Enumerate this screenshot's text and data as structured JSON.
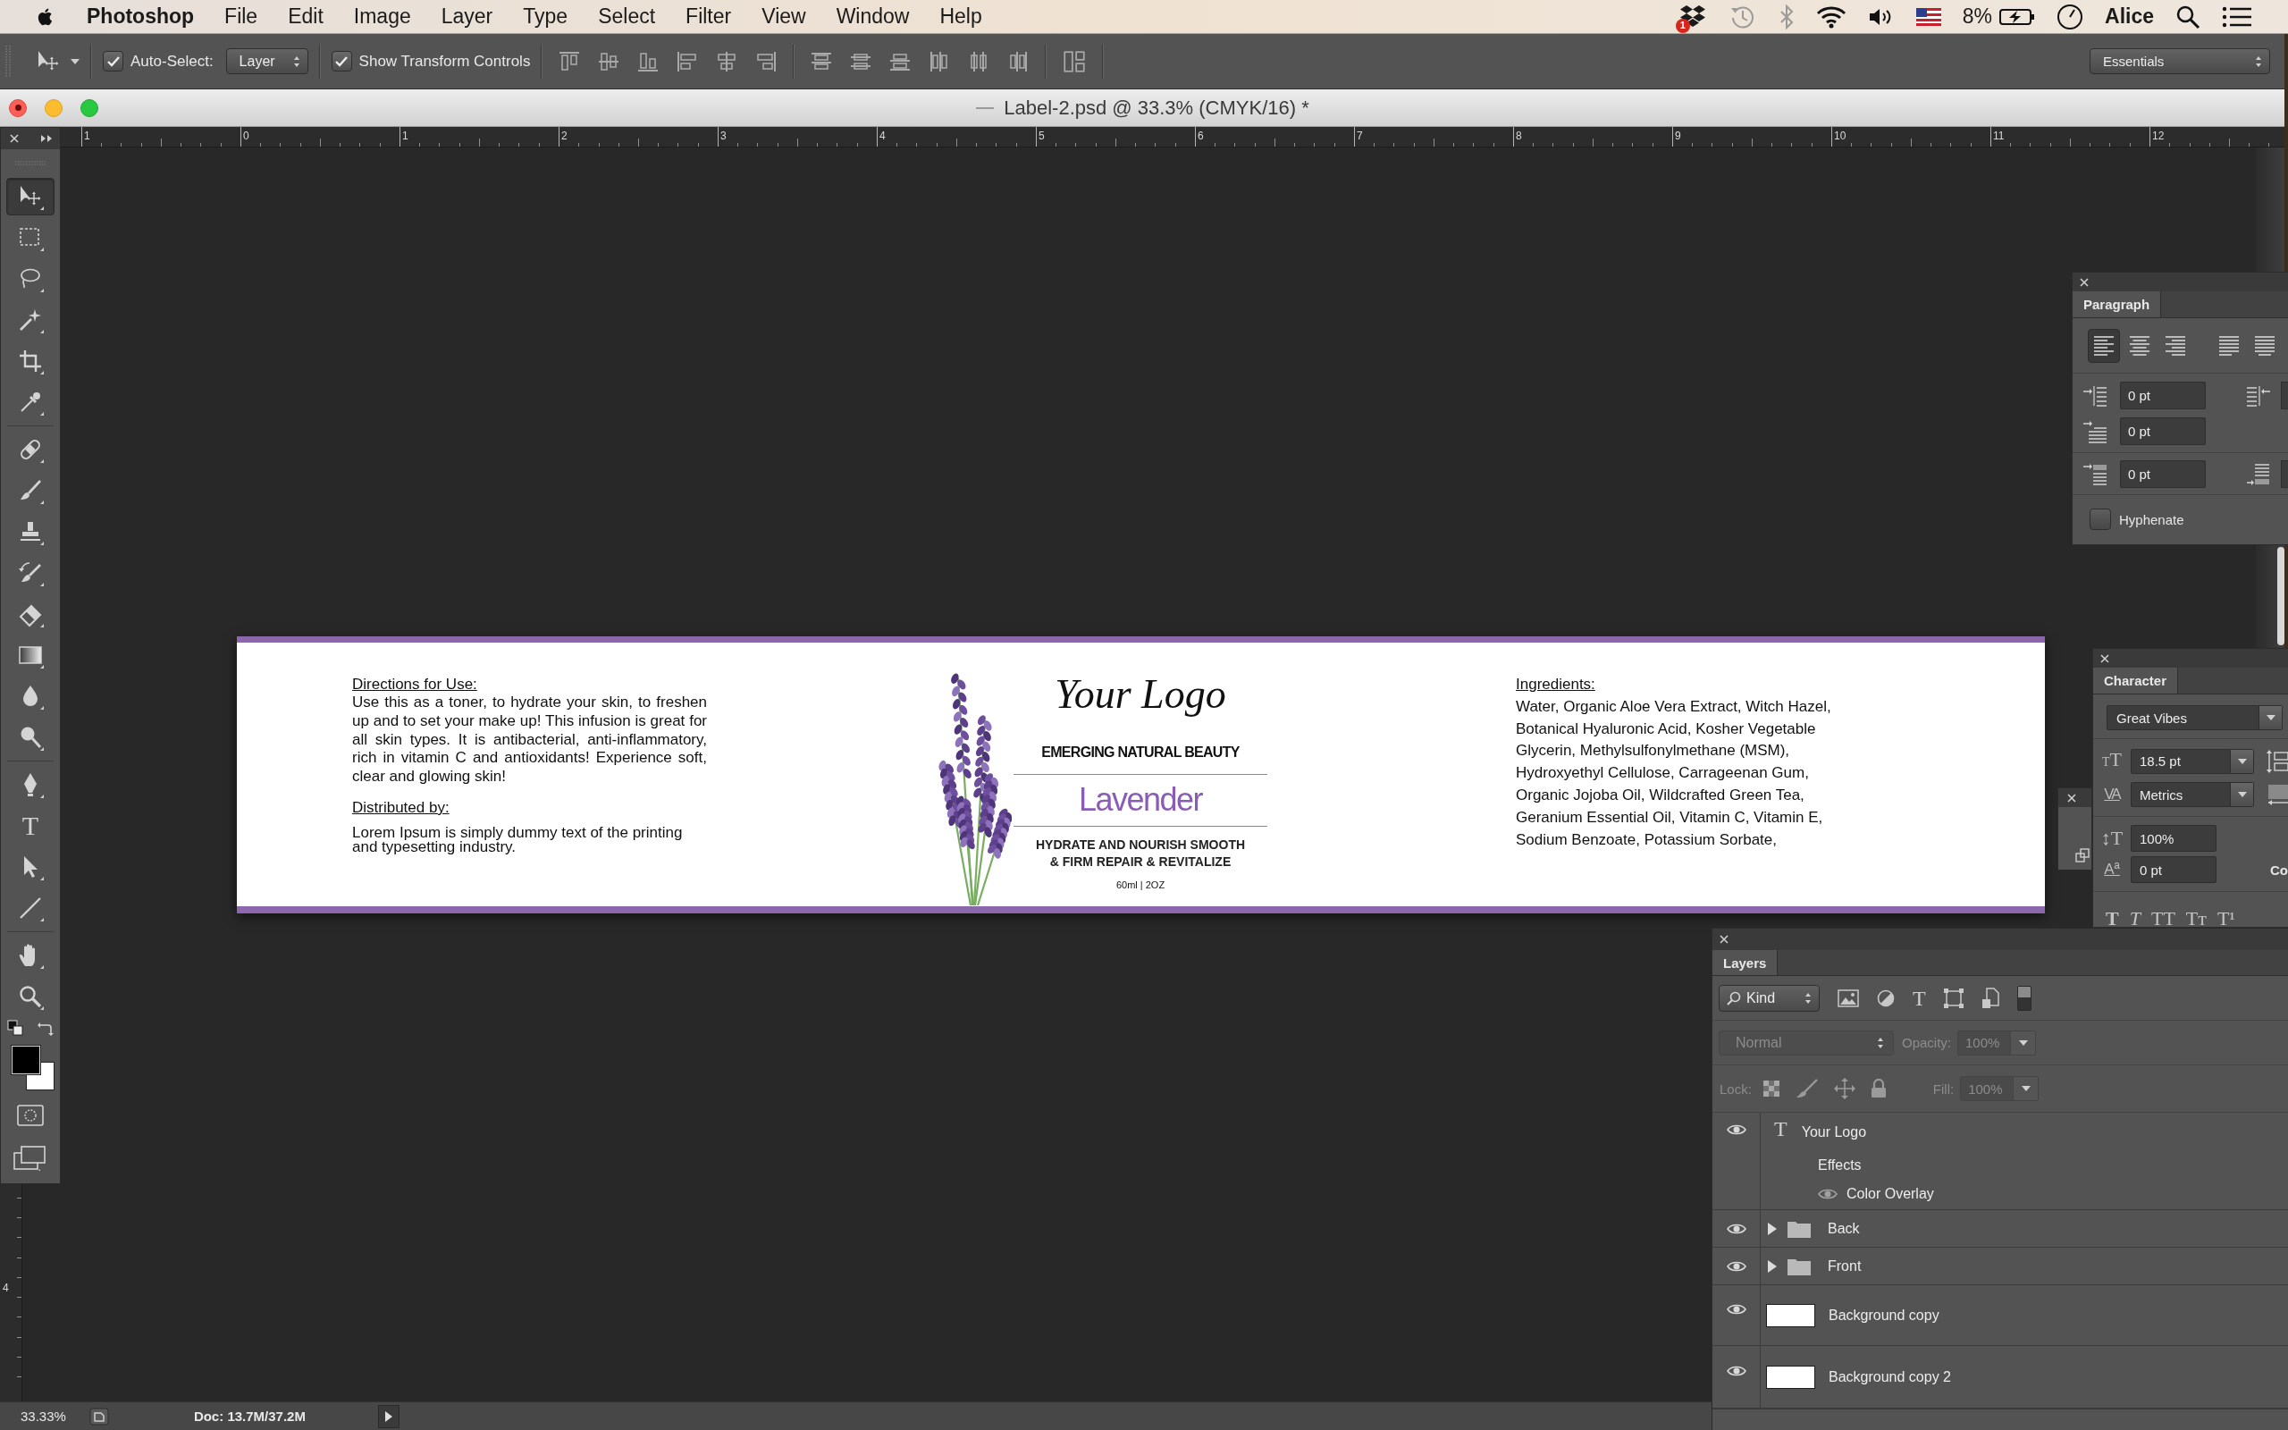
{
  "menu_bar": {
    "app_name": "Photoshop",
    "items": [
      "File",
      "Edit",
      "Image",
      "Layer",
      "Type",
      "Select",
      "Filter",
      "View",
      "Window",
      "Help"
    ],
    "notification_count": "1",
    "battery": "8%",
    "user": "Alice"
  },
  "options_bar": {
    "auto_select": {
      "label": "Auto-Select:",
      "checked": true
    },
    "auto_select_target": "Layer",
    "transform_controls": {
      "label": "Show Transform Controls",
      "checked": true
    },
    "workspace": "Essentials"
  },
  "document": {
    "title": "Label-2.psd @ 33.3% (CMYK/16) *",
    "ruler_labels": [
      "1",
      "0",
      "1",
      "2",
      "3",
      "4",
      "5",
      "6",
      "7",
      "8",
      "9",
      "10",
      "11",
      "12"
    ],
    "vertical_ruler_labels": [
      "4"
    ],
    "label": {
      "directions": {
        "heading": "Directions for Use:",
        "text": "Use this as a toner, to hydrate your skin, to freshen up and to set your make up! This infusion is great for all skin types. It is antibacterial, anti-inflammatory, rich in vitamin C and antioxidants! Experience soft, clear and glowing skin!"
      },
      "distributor": {
        "heading": "Distributed by:",
        "text": "Lorem Ipsum is simply dummy text of the printing and typesetting industry."
      },
      "logo": "Your Logo",
      "tagline": "EMERGING NATURAL BEAUTY",
      "product": "Lavender",
      "claims": [
        "HYDRATE AND NOURISH SMOOTH",
        "& FIRM REPAIR & REVITALIZE"
      ],
      "size": "60ml | 2OZ",
      "ingredients": {
        "heading": "Ingredients:",
        "text": "Water, Organic Aloe Vera Extract, Witch Hazel, Botanical Hyaluronic Acid, Kosher Vegetable Glycerin, Methylsulfonylmethane (MSM), Hydroxyethyl Cellulose, Carrageenan Gum, Organic Jojoba Oil, Wildcrafted Green Tea, Geranium Essential Oil, Vitamin C, Vitamin E, Sodium Benzoate, Potassium Sorbate,"
      }
    }
  },
  "tools": {
    "groups": [
      [
        {
          "kind": "move",
          "selected": true
        },
        {
          "kind": "marquee",
          "selected": false
        },
        {
          "kind": "lasso",
          "selected": false
        },
        {
          "kind": "wand",
          "selected": false
        },
        {
          "kind": "crop",
          "selected": false
        },
        {
          "kind": "eyedropper",
          "selected": false
        }
      ],
      [
        {
          "kind": "healing",
          "selected": false
        },
        {
          "kind": "brush",
          "selected": false
        },
        {
          "kind": "stamp",
          "selected": false
        },
        {
          "kind": "history",
          "selected": false
        },
        {
          "kind": "eraser",
          "selected": false
        },
        {
          "kind": "gradient",
          "selected": false
        },
        {
          "kind": "blur",
          "selected": false
        },
        {
          "kind": "dodge",
          "selected": false
        }
      ],
      [
        {
          "kind": "pen",
          "selected": false
        },
        {
          "kind": "type",
          "glyph": "T",
          "selected": false
        },
        {
          "kind": "path",
          "selected": false
        },
        {
          "kind": "line",
          "selected": false
        }
      ],
      [
        {
          "kind": "hand",
          "selected": false
        },
        {
          "kind": "zoom",
          "selected": false
        }
      ]
    ],
    "swatches": [
      {
        "kind": "foreground",
        "color": "#000000"
      },
      {
        "kind": "background",
        "color": "#ffffff"
      }
    ]
  },
  "status_bar": {
    "zoom": "33.33%",
    "doc_info": "Doc: 13.7M/37.2M"
  },
  "paragraph_panel": {
    "tab": "Paragraph",
    "alignments": [
      {
        "kind": "left",
        "selected": true
      },
      {
        "kind": "center",
        "selected": false
      },
      {
        "kind": "right",
        "selected": false
      },
      {
        "kind": "justify_left",
        "selected": false
      },
      {
        "kind": "justify_center",
        "selected": false
      }
    ],
    "fields": [
      {
        "kind": "indent_left",
        "value": "0 pt"
      },
      {
        "kind": "first_line",
        "value": "0 pt"
      },
      {
        "kind": "space_before",
        "value": "0 pt"
      }
    ],
    "hyphenate": {
      "label": "Hyphenate",
      "checked": false
    }
  },
  "character_panel": {
    "tab": "Character",
    "font_family": "Great Vibes",
    "fields": [
      {
        "kind": "size",
        "glyph": "TT",
        "value": "18.5 pt"
      },
      {
        "kind": "kerning",
        "glyph": "VA",
        "value": "Metrics"
      },
      {
        "kind": "vertical_scale",
        "glyph": "↕T",
        "value": "100%"
      },
      {
        "kind": "baseline",
        "glyph": "Aª",
        "value": "0 pt"
      }
    ],
    "color_label": "Co",
    "style_buttons": [
      {
        "kind": "bold",
        "glyph": "T"
      },
      {
        "kind": "italic",
        "glyph": "T"
      },
      {
        "kind": "caps",
        "glyph": "TT"
      },
      {
        "kind": "small_caps",
        "glyph": "Tᴛ"
      },
      {
        "kind": "superscript",
        "glyph": "T¹"
      }
    ]
  },
  "layers_panel": {
    "tab": "Layers",
    "filter": "Kind",
    "type_filter_glyph": "T",
    "filter_on": true,
    "blend": {
      "mode": "Normal",
      "opacity_label": "Opacity:",
      "opacity": "100%",
      "lock_label": "Lock:",
      "fill_label": "Fill:",
      "fill": "100%",
      "disabled": true
    },
    "layers": [
      {
        "kind": "text",
        "glyph": "T",
        "name": "Your Logo",
        "visible": true,
        "effects_label": "Effects",
        "effects": [
          {
            "name": "Color Overlay",
            "visible": true
          }
        ]
      },
      {
        "kind": "group",
        "name": "Back",
        "visible": true,
        "expanded": false
      },
      {
        "kind": "group",
        "name": "Front",
        "visible": true,
        "expanded": false
      },
      {
        "kind": "pixel",
        "name": "Background copy",
        "visible": true
      },
      {
        "kind": "pixel",
        "name": "Background copy 2",
        "visible": true
      }
    ]
  }
}
